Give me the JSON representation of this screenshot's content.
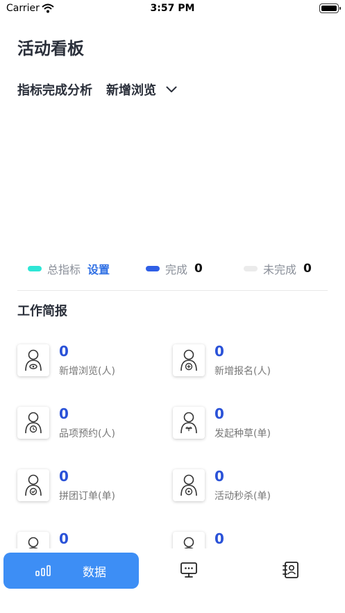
{
  "status_bar": {
    "carrier": "Carrier",
    "time": "3:57 PM"
  },
  "page": {
    "title": "活动看板"
  },
  "indicator": {
    "section_label": "指标完成分析",
    "selected_metric": "新增浏览"
  },
  "legend": {
    "total": {
      "label": "总指标",
      "action": "设置",
      "color": "#2ee6d6"
    },
    "done": {
      "label": "完成",
      "value": "0",
      "color": "#2f5fe6"
    },
    "undone": {
      "label": "未完成",
      "value": "0",
      "color": "#ebebeb"
    }
  },
  "report": {
    "title": "工作简报",
    "items": [
      {
        "value": "0",
        "label": "新增浏览(人)",
        "icon": "user-eye-icon"
      },
      {
        "value": "0",
        "label": "新增报名(人)",
        "icon": "user-plus-icon"
      },
      {
        "value": "0",
        "label": "品项预约(人)",
        "icon": "user-clock-icon"
      },
      {
        "value": "0",
        "label": "发起种草(单)",
        "icon": "user-sprout-icon"
      },
      {
        "value": "0",
        "label": "拼团订单(单)",
        "icon": "user-check-icon"
      },
      {
        "value": "0",
        "label": "活动秒杀(单)",
        "icon": "user-flash-icon"
      },
      {
        "value": "0",
        "label": "",
        "icon": "user-icon"
      },
      {
        "value": "0",
        "label": "",
        "icon": "user-icon"
      }
    ]
  },
  "tabs": [
    {
      "label": "数据",
      "icon": "bar-chart-icon",
      "active": true
    },
    {
      "label": "",
      "icon": "monitor-chat-icon",
      "active": false
    },
    {
      "label": "",
      "icon": "contact-book-icon",
      "active": false
    }
  ]
}
